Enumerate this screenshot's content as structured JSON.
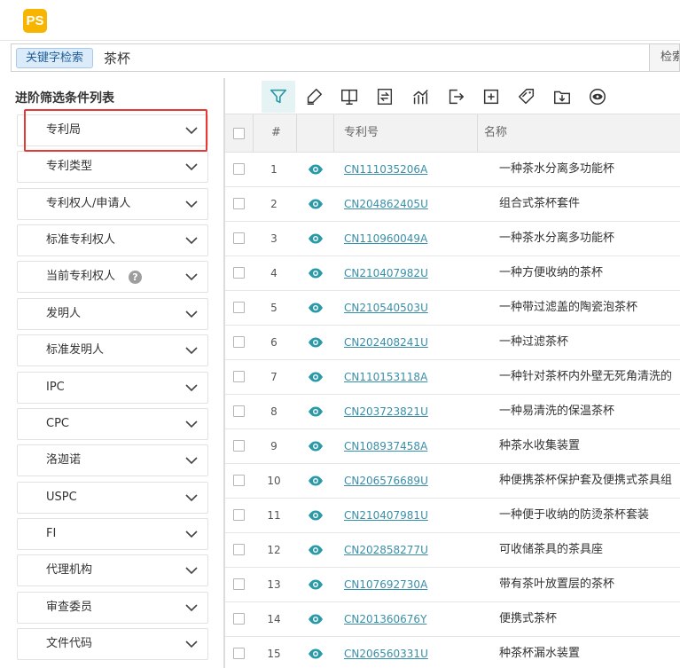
{
  "app": {
    "logo_text": "PS"
  },
  "search": {
    "keyword_tag": "关键字检索",
    "query": "茶杯",
    "button_label": "检索"
  },
  "sidebar": {
    "title": "进阶筛选条件列表",
    "filters": [
      {
        "label": "专利局"
      },
      {
        "label": "专利类型"
      },
      {
        "label": "专利权人/申请人"
      },
      {
        "label": "标准专利权人"
      },
      {
        "label": "当前专利权人",
        "help": "?"
      },
      {
        "label": "发明人"
      },
      {
        "label": "标准发明人"
      },
      {
        "label": "IPC"
      },
      {
        "label": "CPC"
      },
      {
        "label": "洛迦诺"
      },
      {
        "label": "USPC"
      },
      {
        "label": "FI"
      },
      {
        "label": "代理机构"
      },
      {
        "label": "审查委员"
      },
      {
        "label": "文件代码"
      }
    ]
  },
  "toolbar": {
    "icons": [
      "filter-icon",
      "highlighter-icon",
      "monitor-icon",
      "compare-icon",
      "chart-icon",
      "export-icon",
      "add-icon",
      "tag-icon",
      "save-folder-icon",
      "eye-settings-icon"
    ]
  },
  "table": {
    "headers": {
      "index": "#",
      "patent_no": "专利号",
      "title": "名称"
    },
    "rows": [
      {
        "index": "1",
        "patent_no": "CN111035206A",
        "title": "一种茶水分离多功能杯"
      },
      {
        "index": "2",
        "patent_no": "CN204862405U",
        "title": "组合式茶杯套件"
      },
      {
        "index": "3",
        "patent_no": "CN110960049A",
        "title": "一种茶水分离多功能杯"
      },
      {
        "index": "4",
        "patent_no": "CN210407982U",
        "title": "一种方便收纳的茶杯"
      },
      {
        "index": "5",
        "patent_no": "CN210540503U",
        "title": "一种带过滤盖的陶瓷泡茶杯"
      },
      {
        "index": "6",
        "patent_no": "CN202408241U",
        "title": "一种过滤茶杯"
      },
      {
        "index": "7",
        "patent_no": "CN110153118A",
        "title": "一种针对茶杯内外壁无死角清洗的"
      },
      {
        "index": "8",
        "patent_no": "CN203723821U",
        "title": "一种易清洗的保温茶杯"
      },
      {
        "index": "9",
        "patent_no": "CN108937458A",
        "title": "种茶水收集装置"
      },
      {
        "index": "10",
        "patent_no": "CN206576689U",
        "title": "种便携茶杯保护套及便携式茶具组"
      },
      {
        "index": "11",
        "patent_no": "CN210407981U",
        "title": "一种便于收纳的防烫茶杯套装"
      },
      {
        "index": "12",
        "patent_no": "CN202858277U",
        "title": "可收储茶具的茶具座"
      },
      {
        "index": "13",
        "patent_no": "CN107692730A",
        "title": "带有茶叶放置层的茶杯"
      },
      {
        "index": "14",
        "patent_no": "CN201360676Y",
        "title": "便携式茶杯"
      },
      {
        "index": "15",
        "patent_no": "CN206560331U",
        "title": "种茶杯漏水装置"
      }
    ]
  },
  "colors": {
    "accent": "#3a8fa8",
    "logo": "#f7b500",
    "highlight": "#e53935"
  }
}
